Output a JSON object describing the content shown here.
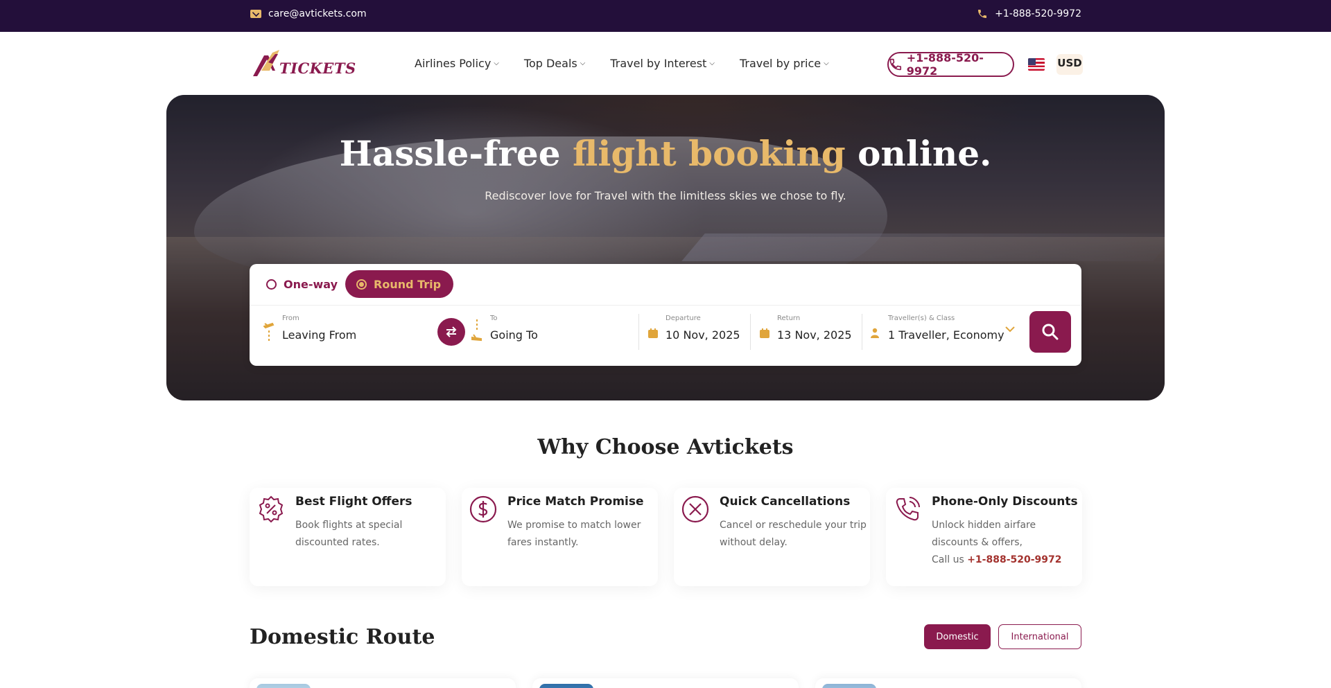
{
  "topbar": {
    "email": "care@avtickets.com",
    "phone": "+1-888-520-9972"
  },
  "header": {
    "logo_text": "TICKETS",
    "nav": [
      {
        "label": "Airlines Policy"
      },
      {
        "label": "Top Deals"
      },
      {
        "label": "Travel by Interest"
      },
      {
        "label": "Travel by price"
      }
    ],
    "phone_button": "+1-888-520-9972",
    "currency": "USD"
  },
  "hero": {
    "title_part1": "Hassle-free ",
    "title_highlight": "flight booking",
    "title_part2": " online.",
    "subtitle": "Rediscover love for Travel with the limitless skies we chose to fly."
  },
  "search": {
    "trip_types": [
      {
        "label": "One-way",
        "selected": false
      },
      {
        "label": "Round Trip",
        "selected": true
      }
    ],
    "from": {
      "label": "From",
      "value": "Leaving From"
    },
    "to": {
      "label": "To",
      "value": "Going To"
    },
    "departure": {
      "label": "Departure",
      "value": "10 Nov, 2025"
    },
    "return": {
      "label": "Return",
      "value": "13 Nov, 2025"
    },
    "travellers": {
      "label": "Traveller(s) & Class",
      "value": "1 Traveller, Economy"
    }
  },
  "why": {
    "title": "Why Choose Avtickets",
    "features": [
      {
        "title": "Best Flight Offers",
        "desc": "Book flights at special discounted rates.",
        "icon": "discount-badge-icon"
      },
      {
        "title": "Price Match Promise",
        "desc": "We promise to match lower fares instantly.",
        "icon": "dollar-circle-icon"
      },
      {
        "title": "Quick Cancellations",
        "desc": "Cancel or reschedule your trip without delay.",
        "icon": "cancel-circle-icon"
      },
      {
        "title": "Phone-Only Discounts",
        "desc": "Unlock hidden airfare discounts & offers,",
        "desc2": "Call us ",
        "phone": "+1-888-520-9972",
        "icon": "phone-call-icon"
      }
    ]
  },
  "routes": {
    "title": "Domestic Route",
    "tabs": [
      {
        "label": "Domestic",
        "active": true
      },
      {
        "label": "International",
        "active": false
      }
    ]
  },
  "colors": {
    "primary": "#8a1a4e",
    "accent": "#e8b96a",
    "topbar": "#230f3a"
  }
}
